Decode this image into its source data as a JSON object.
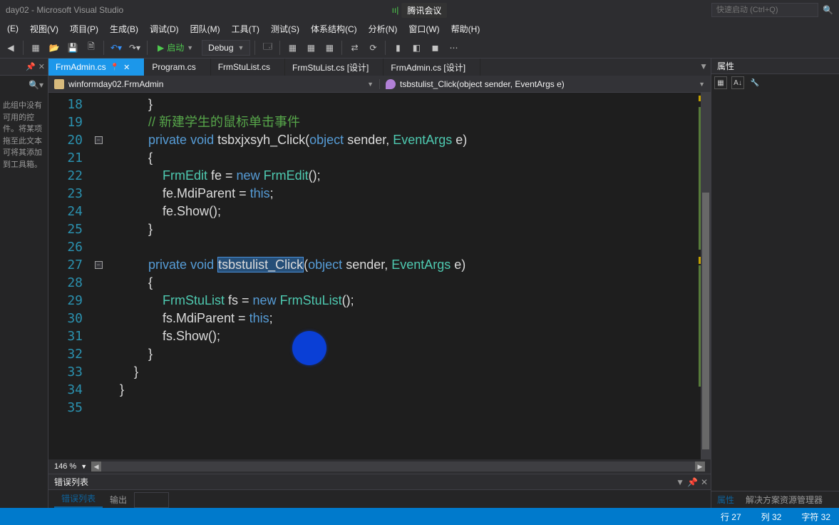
{
  "title": "day02 - Microsoft Visual Studio",
  "meeting": {
    "signal": "ıı|",
    "label": "腾讯会议"
  },
  "quick_launch": {
    "placeholder": "快速启动 (Ctrl+Q)"
  },
  "menu": [
    "(E)",
    "视图(V)",
    "项目(P)",
    "生成(B)",
    "调试(D)",
    "团队(M)",
    "工具(T)",
    "测试(S)",
    "体系结构(C)",
    "分析(N)",
    "窗口(W)",
    "帮助(H)"
  ],
  "toolbar": {
    "start": "启动",
    "config": "Debug"
  },
  "left_panel": {
    "body": "此组中没有可用的控件。将某项拖至此文本可将其添加到工具箱。"
  },
  "tabs": [
    {
      "label": "FrmAdmin.cs",
      "active": true,
      "pinned": true
    },
    {
      "label": "Program.cs",
      "active": false
    },
    {
      "label": "FrmStuList.cs",
      "active": false
    },
    {
      "label": "FrmStuList.cs [设计]",
      "active": false
    },
    {
      "label": "FrmAdmin.cs [设计]",
      "active": false
    }
  ],
  "nav": {
    "left": "winformday02.FrmAdmin",
    "right": "tsbstulist_Click(object sender, EventArgs e)"
  },
  "code": {
    "first_line": 18,
    "lines": [
      {
        "n": 18,
        "html": "            <span class='paren'>}</span>"
      },
      {
        "n": 19,
        "html": "            <span class='comment'>// 新建学生的鼠标单击事件</span>"
      },
      {
        "n": 20,
        "fold": "-",
        "html": "            <span class='kw'>private</span> <span class='kw'>void</span> <span class='method'>tsbxjxsyh_Click</span>(<span class='kw'>object</span> sender, <span class='type'>EventArgs</span> e)"
      },
      {
        "n": 21,
        "html": "            <span class='paren'>{</span>"
      },
      {
        "n": 22,
        "html": "                <span class='type'>FrmEdit</span> fe = <span class='kw'>new</span> <span class='type'>FrmEdit</span>();"
      },
      {
        "n": 23,
        "html": "                fe.MdiParent = <span class='kw'>this</span>;"
      },
      {
        "n": 24,
        "html": "                fe.Show();"
      },
      {
        "n": 25,
        "html": "            <span class='paren'>}</span>"
      },
      {
        "n": 26,
        "html": ""
      },
      {
        "n": 27,
        "fold": "-",
        "html": "            <span class='kw'>private</span> <span class='kw'>void</span> <span class='sel'>tsbstulist_Click</span>(<span class='kw'>object</span> sender, <span class='type'>EventArgs</span> e)"
      },
      {
        "n": 28,
        "html": "            <span class='paren'>{</span>"
      },
      {
        "n": 29,
        "html": "                <span class='type'>FrmStuList</span> fs = <span class='kw'>new</span> <span class='type'>FrmStuList</span>();"
      },
      {
        "n": 30,
        "html": "                fs.MdiParent = <span class='kw'>this</span>;"
      },
      {
        "n": 31,
        "html": "                fs.Show();"
      },
      {
        "n": 32,
        "html": "            <span class='paren'>}</span>"
      },
      {
        "n": 33,
        "html": "        <span class='paren'>}</span>"
      },
      {
        "n": 34,
        "html": "    <span class='paren'>}</span>"
      },
      {
        "n": 35,
        "html": ""
      }
    ]
  },
  "zoom": "146 %",
  "error_panel": {
    "title": "错误列表",
    "tabs": [
      "错误列表",
      "输出"
    ]
  },
  "right_panel": {
    "title": "属性",
    "bottom_tabs": [
      "属性",
      "解决方案资源管理器"
    ]
  },
  "status": {
    "line": "行 27",
    "col": "列 32",
    "char": "字符 32"
  }
}
